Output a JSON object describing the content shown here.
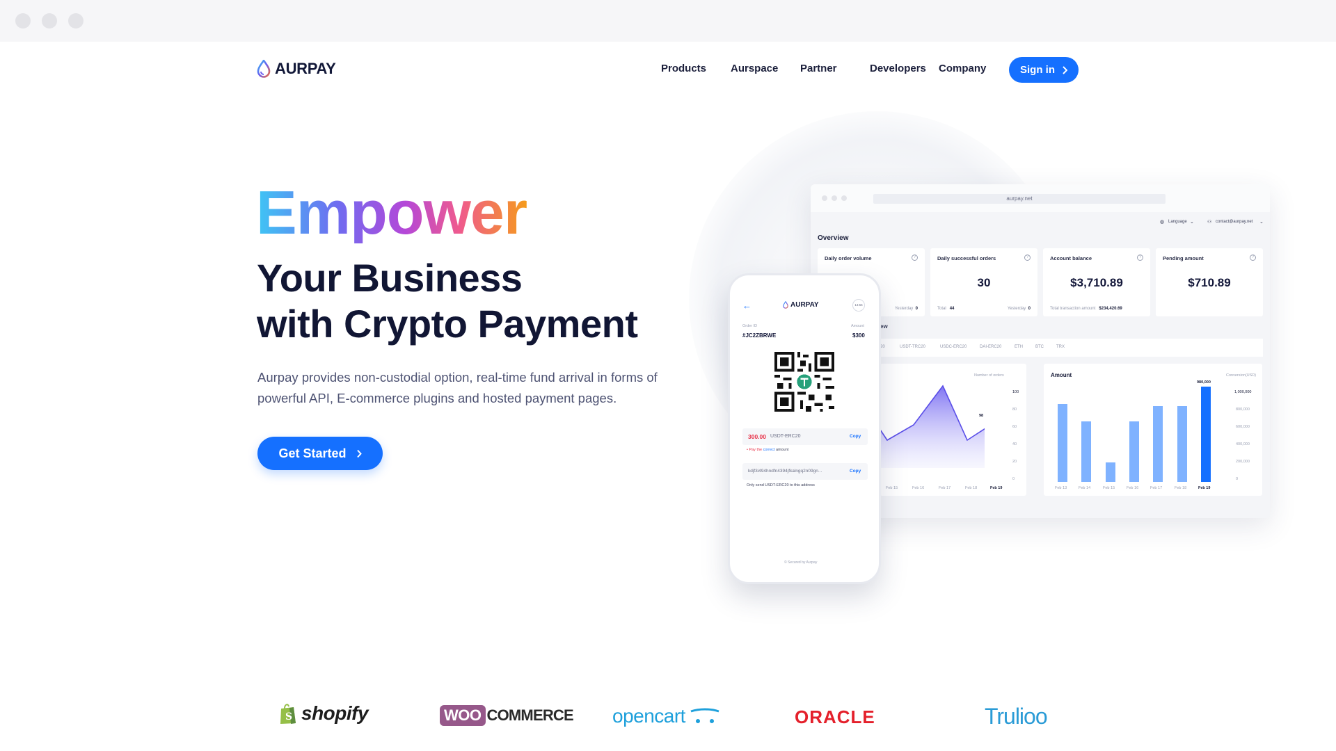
{
  "browser": {
    "window_controls": [
      "close",
      "minimize",
      "maximize"
    ]
  },
  "brand": {
    "name": "AURPAY",
    "primary_color": "#1570ff",
    "text_color": "#111634"
  },
  "nav": {
    "items": [
      "Products",
      "Aurspace",
      "Partner",
      "Developers",
      "Company"
    ],
    "signin_label": "Sign in"
  },
  "hero": {
    "highlight": "Empower",
    "headline_line1": "Your Business",
    "headline_line2": "with Crypto Payment",
    "description": "Aurpay provides non-custodial option, real-time fund arrival in forms of powerful API, E-commerce plugins and hosted payment pages.",
    "cta_label": "Get Started"
  },
  "dashboard": {
    "url": "aurpay.net",
    "language_label": "Language",
    "account_email": "contact@aurpay.net",
    "overview_title": "Overview",
    "cards": [
      {
        "title": "Daily order volume",
        "value": "",
        "foot_left": "",
        "foot_right_label": "Yesterday",
        "foot_right_value": "0"
      },
      {
        "title": "Daily successful orders",
        "value": "30",
        "foot_left_label": "Total",
        "foot_left_value": "44",
        "foot_right_label": "Yesterday",
        "foot_right_value": "0"
      },
      {
        "title": "Account balance",
        "value": "$3,710.89",
        "foot_left_label": "Total transaction amount",
        "foot_left_value": "$234,420.69"
      },
      {
        "title": "Pending amount",
        "value": "$710.89"
      }
    ],
    "section_partial": "ew",
    "currency_tabs": [
      "20",
      "USDT-TRC20",
      "USDC-ERC20",
      "DAI-ERC20",
      "ETH",
      "BTC",
      "TRX"
    ],
    "orders_chart": {
      "axis_title": "Number of orders",
      "y_ticks": [
        "100",
        "80",
        "60",
        "40",
        "20",
        "0"
      ],
      "x_labels": [
        "Feb 15",
        "Feb 16",
        "Feb 17",
        "Feb 18",
        "Feb 19"
      ],
      "peak_label": "98"
    },
    "amount_chart": {
      "title": "Amount",
      "axis_title": "Conversion(USD)",
      "y_ticks": [
        "1,000,000",
        "800,000",
        "600,000",
        "400,000",
        "200,000",
        "0"
      ],
      "x_labels": [
        "Feb 13",
        "Feb 14",
        "Feb 15",
        "Feb 16",
        "Feb 17",
        "Feb 18",
        "Feb 19"
      ],
      "values": [
        0.8,
        0.62,
        0.2,
        0.62,
        0.78,
        0.78,
        0.98
      ],
      "peak_label": "980,000",
      "highlight_color": "#1570ff",
      "bar_color": "#7fb2ff"
    }
  },
  "phone": {
    "brand": "AURPAY",
    "order_id_label": "Order ID",
    "order_id": "#JC2ZBRWE",
    "amount_label": "Amount",
    "amount": "$300",
    "pay_amount": "300.00",
    "pay_currency": "USDT-ERC20",
    "copy_label": "Copy",
    "pay_note_prefix": "• Pay the",
    "pay_note_highlight": "correct",
    "pay_note_suffix": "amount",
    "address": "kdjf3i494hndfn4394jfkalngq2n09gn...",
    "address_note": "Only send USDT-ERC20 to this address",
    "footer": "© Secured by Aurpay",
    "timer": "14:56"
  },
  "partners": [
    "shopify",
    "WOO",
    "COMMERCE",
    "opencart",
    "ORACLE",
    "Trulioo"
  ]
}
